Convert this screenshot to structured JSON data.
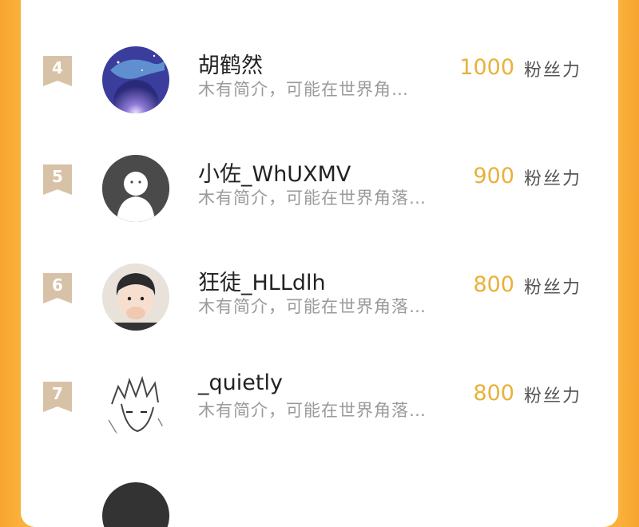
{
  "rows": [
    {
      "rank": "4",
      "name": "胡鹤然",
      "desc": "木有简介，可能在世界角…",
      "count": "1000",
      "unit": "粉丝力"
    },
    {
      "rank": "5",
      "name": "小佐_WhUXMV",
      "desc": "木有简介，可能在世界角落…",
      "count": "900",
      "unit": "粉丝力"
    },
    {
      "rank": "6",
      "name": "狂徒_HLLdlh",
      "desc": "木有简介，可能在世界角落…",
      "count": "800",
      "unit": "粉丝力"
    },
    {
      "rank": "7",
      "name": "_quietly",
      "desc": "木有简介，可能在世界角落…",
      "count": "800",
      "unit": "粉丝力"
    }
  ]
}
